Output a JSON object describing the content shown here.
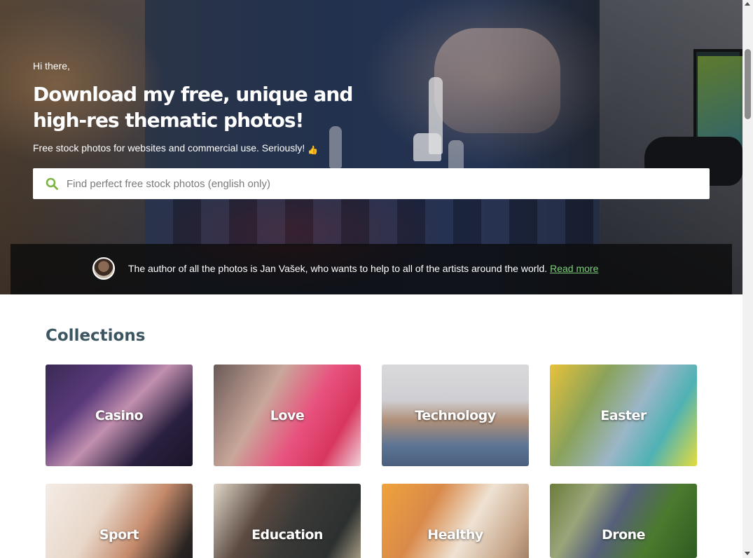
{
  "hero": {
    "greeting": "Hi there,",
    "title": "Download my free, unique and high-res thematic photos!",
    "subtitle": "Free stock photos for websites and commercial use. Seriously!",
    "subtitle_emoji": "👍"
  },
  "search": {
    "placeholder": "Find perfect free stock photos (english only)",
    "value": "",
    "icon": "search-icon",
    "icon_color": "#7cb342"
  },
  "author_bar": {
    "text": "The author of all the photos is Jan Vašek, who wants to help to all of the artists around the world.",
    "link_label": "Read more",
    "link_color": "#7fcf7a"
  },
  "collections": {
    "title": "Collections",
    "items": [
      {
        "label": "Casino"
      },
      {
        "label": "Love"
      },
      {
        "label": "Technology"
      },
      {
        "label": "Easter"
      },
      {
        "label": "Sport"
      },
      {
        "label": "Education"
      },
      {
        "label": "Healthy"
      },
      {
        "label": "Drone"
      }
    ]
  },
  "colors": {
    "heading": "#3b5561",
    "accent_green": "#7cb342"
  }
}
